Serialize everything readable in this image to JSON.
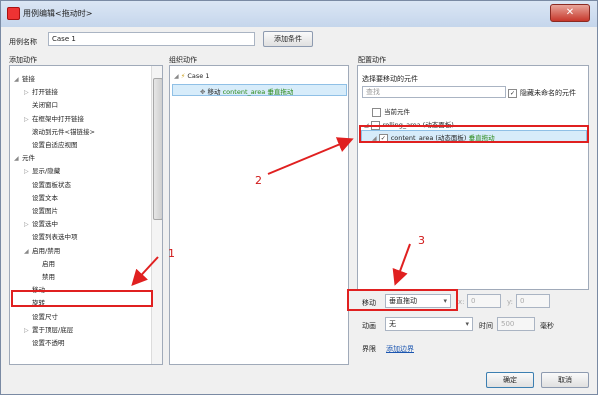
{
  "window": {
    "title": "用例编辑<拖动时>",
    "close_glyph": "✕"
  },
  "case_name": {
    "label": "用例名称",
    "value": "Case 1",
    "add_condition": "添加条件"
  },
  "add_actions": {
    "header": "添加动作",
    "items": [
      {
        "text": "链接",
        "expander": "◢",
        "level": 0
      },
      {
        "text": "打开链接",
        "expander": "▷",
        "level": 1
      },
      {
        "text": "关闭窗口",
        "expander": "",
        "level": 1
      },
      {
        "text": "在框架中打开链接",
        "expander": "▷",
        "level": 1
      },
      {
        "text": "滚动到元件<锚链接>",
        "expander": "",
        "level": 1
      },
      {
        "text": "设置自适应视图",
        "expander": "",
        "level": 1
      },
      {
        "text": "元件",
        "expander": "◢",
        "level": 0
      },
      {
        "text": "显示/隐藏",
        "expander": "▷",
        "level": 1
      },
      {
        "text": "设置面板状态",
        "expander": "",
        "level": 1
      },
      {
        "text": "设置文本",
        "expander": "",
        "level": 1
      },
      {
        "text": "设置图片",
        "expander": "",
        "level": 1
      },
      {
        "text": "设置选中",
        "expander": "▷",
        "level": 1
      },
      {
        "text": "设置列表选中项",
        "expander": "",
        "level": 1
      },
      {
        "text": "启用/禁用",
        "expander": "◢",
        "level": 1
      },
      {
        "text": "启用",
        "expander": "",
        "level": 2
      },
      {
        "text": "禁用",
        "expander": "",
        "level": 2
      },
      {
        "text": "移动",
        "expander": "",
        "level": 1
      },
      {
        "text": "旋转",
        "expander": "",
        "level": 1
      },
      {
        "text": "设置尺寸",
        "expander": "",
        "level": 1
      },
      {
        "text": "置于顶层/底层",
        "expander": "▷",
        "level": 1
      },
      {
        "text": "设置不透明",
        "expander": "",
        "level": 1
      }
    ]
  },
  "organize_actions": {
    "header": "组织动作",
    "case_label": "Case 1",
    "action_verb": "移动",
    "action_target": "content_area",
    "action_mode": "垂直拖动"
  },
  "configure_actions": {
    "header": "配置动作",
    "select_label": "选择要移动的元件",
    "search_placeholder": "查找",
    "hide_unnamed": "隐藏未命名的元件",
    "widgets": [
      {
        "text": "当前元件",
        "checked": false,
        "level": 1,
        "extra": ""
      },
      {
        "text": "rolling_area (动态面板)",
        "checked": false,
        "level": 1,
        "extra": ""
      },
      {
        "text": "content_area (动态面板)",
        "checked": true,
        "level": 2,
        "extra": "垂直拖动"
      }
    ],
    "move_label": "移动",
    "move_value": "垂直拖动",
    "x_label": "x:",
    "x_value": "0",
    "y_label": "y:",
    "y_value": "0",
    "anim_label": "动画",
    "anim_value": "无",
    "time_label": "时间",
    "time_value": "500",
    "ms_label": "毫秒",
    "boundary_label": "界限",
    "boundary_link": "添加边界"
  },
  "buttons": {
    "ok": "确定",
    "cancel": "取消"
  },
  "annotations": {
    "one": "1",
    "two": "2",
    "three": "3"
  },
  "colors": {
    "annotation": "#e02020",
    "highlight": "#d7ecfa",
    "green_text": "#2b8a1a"
  }
}
